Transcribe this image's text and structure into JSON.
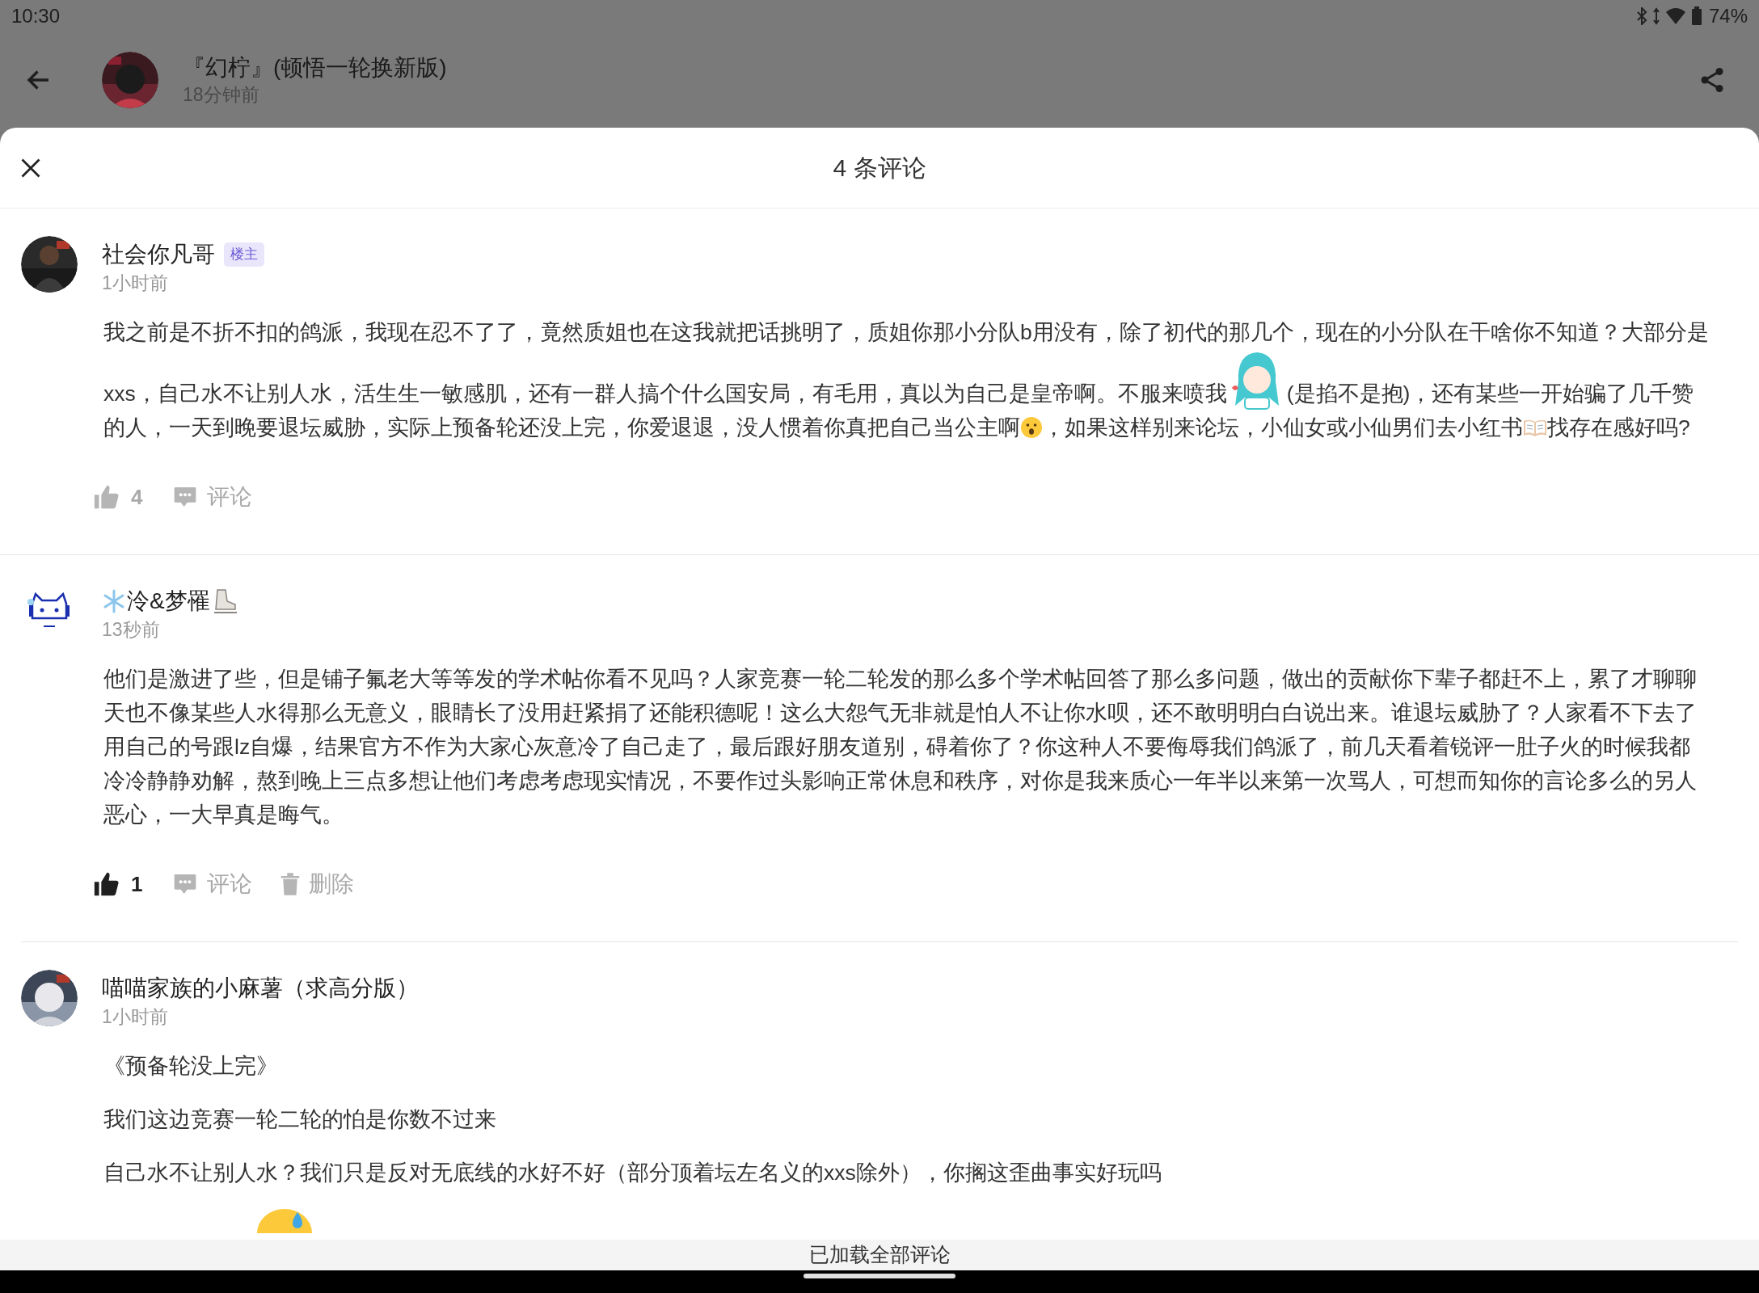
{
  "status_bar": {
    "time": "10:30",
    "battery": "74%"
  },
  "post_header": {
    "title": "『幻柠』(顿悟一轮换新版)",
    "time": "18分钟前"
  },
  "sheet": {
    "title": "4 条评论"
  },
  "comments": [
    {
      "name_parts": [
        {
          "kind": "text",
          "text": "社会你凡哥"
        }
      ],
      "badge": "楼主",
      "time": "1小时前",
      "paragraphs": [
        [
          {
            "kind": "text",
            "text": "我之前是不折不扣的鸽派，我现在忍不了了，竟然质姐也在这我就把话挑明了，质姐你那小分队b用没有，除了初代的那几个，现在的小分队在干啥你不知道？大部分是xxs，自己水不让别人水，活生生一敏感肌，还有一群人搞个什么国安局，有毛用，真以为自己是皇帝啊。不服来喷我"
          },
          {
            "kind": "sticker"
          },
          {
            "kind": "text",
            "text": "(是掐不是抱)，还有某些一开始骗了几千赞的人，一天到晚要退坛威胁，实际上预备轮还没上完，你爱退退，没人惯着你真把自己当公主啊"
          },
          {
            "kind": "surprised-emoji"
          },
          {
            "kind": "text",
            "text": "，如果这样别来论坛，小仙女或小仙男们去小红书"
          },
          {
            "kind": "book-emoji"
          },
          {
            "kind": "text",
            "text": "找存在感好吗?"
          }
        ]
      ],
      "likes": "4",
      "liked": false,
      "reply_label": "评论",
      "divider": {
        "kind": "full"
      }
    },
    {
      "name_parts": [
        {
          "kind": "snowflake"
        },
        {
          "kind": "text",
          "text": "泠&梦罹"
        },
        {
          "kind": "skate"
        }
      ],
      "time": "13秒前",
      "avatar": {
        "kind": "cat"
      },
      "paragraphs": [
        [
          {
            "kind": "text",
            "text": "他们是激进了些，但是铺子氟老大等等发的学术帖你看不见吗？人家竞赛一轮二轮发的那么多个学术帖回答了那么多问题，做出的贡献你下辈子都赶不上，累了才聊聊天也不像某些人水得那么无意义，眼睛长了没用赶紧捐了还能积德呢！这么大怨气无非就是怕人不让你水呗，还不敢明明白白说出来。谁退坛威胁了？人家看不下去了用自己的号跟lz自爆，结果官方不作为大家心灰意冷了自己走了，最后跟好朋友道别，碍着你了？你这种人不要侮辱我们鸽派了，前几天看着锐评一肚子火的时候我都冷冷静静劝解，熬到晚上三点多想让他们考虑考虑现实情况，不要作过头影响正常休息和秩序，对你是我来质心一年半以来第一次骂人，可想而知你的言论多么的另人恶心，一大早真是晦气。"
          }
        ]
      ],
      "likes": "1",
      "liked": true,
      "reply_label": "评论",
      "delete_label": "删除",
      "divider": {
        "kind": "inset"
      }
    },
    {
      "name_parts": [
        {
          "kind": "text",
          "text": "喵喵家族的小麻薯（求高分版）"
        }
      ],
      "time": "1小时前",
      "avatar": {
        "kind": "photo2"
      },
      "paragraphs": [
        [
          {
            "kind": "text",
            "text": "《预备轮没上完》"
          }
        ],
        [
          {
            "kind": "text",
            "text": "我们这边竞赛一轮二轮的怕是你数不过来"
          }
        ],
        [
          {
            "kind": "text",
            "text": "自己水不让别人水？我们只是反对无底线的水好不好（部分顶着坛左名义的xxs除外），你搁这歪曲事实好玩吗"
          }
        ],
        [
          {
            "kind": "sweat-emoji"
          }
        ]
      ]
    }
  ],
  "footer": {
    "text": "已加载全部评论"
  }
}
